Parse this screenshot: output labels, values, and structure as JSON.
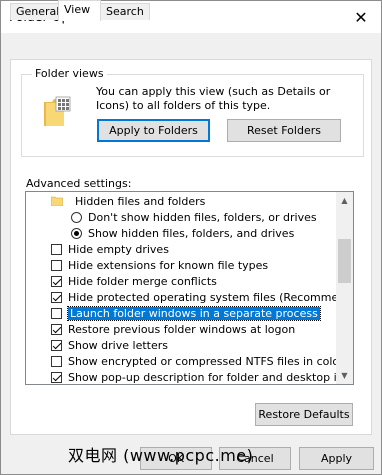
{
  "window": {
    "title": "Folder Options",
    "close_glyph": "✕"
  },
  "tabs": [
    {
      "label": "General"
    },
    {
      "label": "View"
    },
    {
      "label": "Search"
    }
  ],
  "folder_views": {
    "group_label": "Folder views",
    "description": "You can apply this view (such as Details or Icons) to all folders of this type.",
    "apply_button": "Apply to Folders",
    "reset_button": "Reset Folders"
  },
  "advanced": {
    "label": "Advanced settings:",
    "items": [
      {
        "type": "folder",
        "label": "Hidden files and folders"
      },
      {
        "type": "radio",
        "checked": false,
        "label": "Don't show hidden files, folders, or drives"
      },
      {
        "type": "radio",
        "checked": true,
        "label": "Show hidden files, folders, and drives"
      },
      {
        "type": "checkbox",
        "checked": false,
        "label": "Hide empty drives"
      },
      {
        "type": "checkbox",
        "checked": false,
        "label": "Hide extensions for known file types"
      },
      {
        "type": "checkbox",
        "checked": true,
        "label": "Hide folder merge conflicts"
      },
      {
        "type": "checkbox",
        "checked": true,
        "label": "Hide protected operating system files (Recommended)"
      },
      {
        "type": "checkbox",
        "checked": false,
        "label": "Launch folder windows in a separate process",
        "selected": true
      },
      {
        "type": "checkbox",
        "checked": true,
        "label": "Restore previous folder windows at logon"
      },
      {
        "type": "checkbox",
        "checked": true,
        "label": "Show drive letters"
      },
      {
        "type": "checkbox",
        "checked": false,
        "label": "Show encrypted or compressed NTFS files in color"
      },
      {
        "type": "checkbox",
        "checked": true,
        "label": "Show pop-up description for folder and desktop items"
      }
    ],
    "restore_defaults": "Restore Defaults"
  },
  "footer": {
    "ok": "OK",
    "cancel": "Cancel",
    "apply": "Apply"
  },
  "watermark": "双电网 (www.pcpc.me)",
  "colors": {
    "accent": "#0078d7",
    "folder_yellow": "#f8d775"
  }
}
